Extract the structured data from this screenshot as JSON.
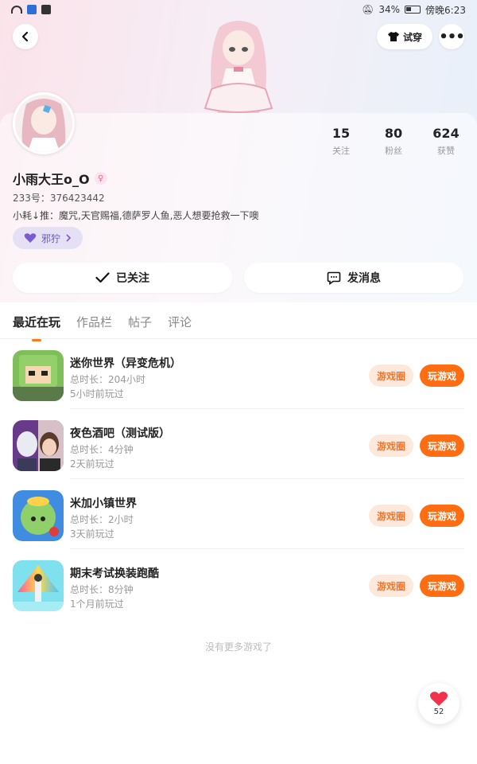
{
  "status_bar": {
    "battery": "34%",
    "time": "傍晚6:23"
  },
  "header": {
    "try_label": "试穿"
  },
  "profile": {
    "name": "小雨大王o_O",
    "gender_icon": "female-icon",
    "uid": "233号：376423442",
    "bio": "小耗↓推：魔咒,天官赐福,德萨罗人鱼,恶人想要抢救一下噢",
    "tag_label": "邪狞",
    "stats": [
      {
        "value": "15",
        "label": "关注"
      },
      {
        "value": "80",
        "label": "粉丝"
      },
      {
        "value": "624",
        "label": "获赞"
      }
    ]
  },
  "actions": {
    "follow_label": "已关注",
    "message_label": "发消息"
  },
  "tabs": [
    {
      "label": "最近在玩",
      "active": true
    },
    {
      "label": "作品栏",
      "active": false
    },
    {
      "label": "帖子",
      "active": false
    },
    {
      "label": "评论",
      "active": false
    }
  ],
  "games": [
    {
      "title": "迷你世界（异变危机）",
      "duration": "总时长：204小时",
      "last_played": "5小时前玩过",
      "circle_label": "游戏圈",
      "play_label": "玩游戏"
    },
    {
      "title": "夜色酒吧（测试版）",
      "duration": "总时长：4分钟",
      "last_played": "2天前玩过",
      "circle_label": "游戏圈",
      "play_label": "玩游戏"
    },
    {
      "title": "米加小镇世界",
      "duration": "总时长：2小时",
      "last_played": "3天前玩过",
      "circle_label": "游戏圈",
      "play_label": "玩游戏"
    },
    {
      "title": "期末考试换装跑酷",
      "duration": "总时长：8分钟",
      "last_played": "1个月前玩过",
      "circle_label": "游戏圈",
      "play_label": "玩游戏"
    }
  ],
  "footer_text": "没有更多游戏了",
  "like": {
    "count": "52"
  },
  "colors": {
    "accent": "#ff6d13",
    "accent_soft": "#fde8dc",
    "tag_bg": "#e6e0f5",
    "heart": "#f0324a"
  }
}
